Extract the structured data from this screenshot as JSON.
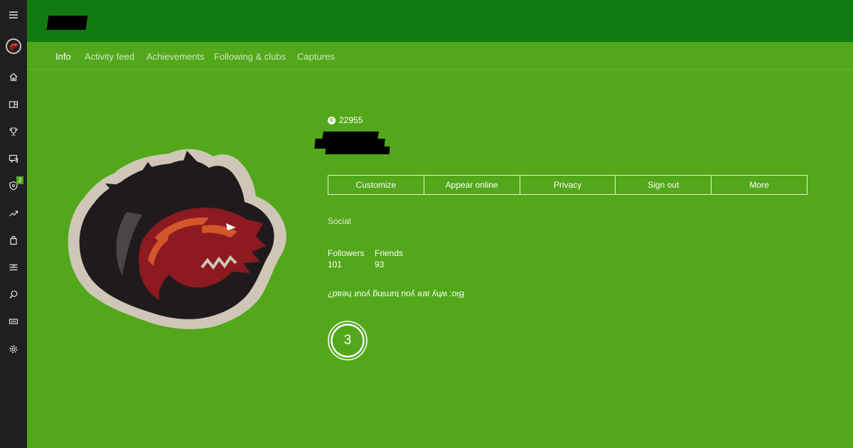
{
  "colors": {
    "sidebar": "#1f1f1f",
    "header": "#107c10",
    "content": "#52a71a",
    "redaction": "#000000"
  },
  "sidebar": {
    "items": [
      {
        "icon": "hamburger-menu-icon"
      },
      {
        "icon": "dragon-avatar-icon"
      },
      {
        "icon": "home-icon"
      },
      {
        "icon": "my-games-icon"
      },
      {
        "icon": "trophy-icon"
      },
      {
        "icon": "messages-icon"
      },
      {
        "icon": "lfg-shield-icon",
        "badge": "2"
      },
      {
        "icon": "trending-icon"
      },
      {
        "icon": "store-icon"
      },
      {
        "icon": "activity-list-icon"
      },
      {
        "icon": "search-icon"
      },
      {
        "icon": "connection-icon"
      },
      {
        "icon": "settings-gear-icon"
      }
    ]
  },
  "tabs": [
    {
      "label": "Info",
      "active": true
    },
    {
      "label": "Activity feed",
      "active": false
    },
    {
      "label": "Achievements",
      "active": false
    },
    {
      "label": "Following & clubs",
      "active": false
    },
    {
      "label": "Captures",
      "active": false
    }
  ],
  "profile": {
    "gamerscore": "22955",
    "gamerscore_icon_letter": "G",
    "avatar_icon": "dragon-avatar-icon"
  },
  "actions": [
    {
      "label": "Customize"
    },
    {
      "label": "Appear online"
    },
    {
      "label": "Privacy"
    },
    {
      "label": "Sign out"
    },
    {
      "label": "More"
    }
  ],
  "social": {
    "heading": "Social",
    "followers_label": "Followers",
    "followers_value": "101",
    "friends_label": "Friends",
    "friends_value": "93"
  },
  "bio": {
    "text": "Bio: why are you turning your head?",
    "rotated_180": true
  },
  "rep_badge": {
    "value": "3"
  }
}
